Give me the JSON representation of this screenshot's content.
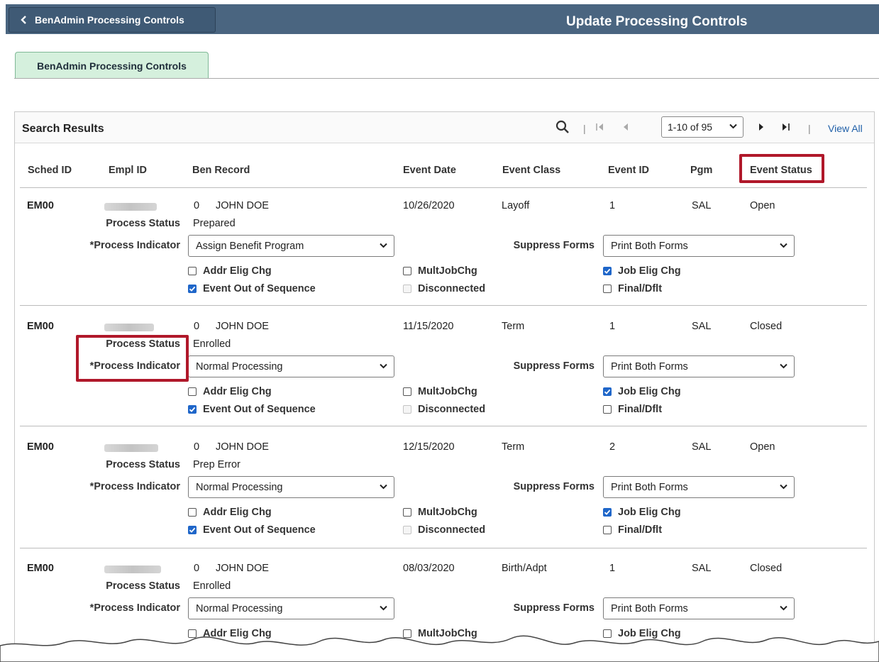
{
  "header": {
    "back_label": "BenAdmin Processing Controls",
    "title": "Update Processing Controls"
  },
  "tab": {
    "label": "BenAdmin Processing Controls"
  },
  "grid": {
    "title": "Search Results",
    "range": "1-10 of 95",
    "view_all": "View All",
    "columns": [
      "Sched ID",
      "Empl ID",
      "Ben Record",
      "Event Date",
      "Event Class",
      "Event ID",
      "Pgm",
      "Event Status"
    ]
  },
  "labels": {
    "process_status": "Process Status",
    "process_indicator": "*Process Indicator",
    "suppress_forms": "Suppress Forms",
    "addr_elig": "Addr Elig Chg",
    "event_oos": "Event Out of Sequence",
    "multjob": "MultJobChg",
    "disconnected": "Disconnected",
    "job_elig": "Job Elig Chg",
    "final_dflt": "Final/Dflt"
  },
  "rows": [
    {
      "sched_id": "EM00",
      "ben_record": "0",
      "name": "JOHN DOE",
      "event_date": "10/26/2020",
      "event_class": "Layoff",
      "event_id": "1",
      "pgm": "SAL",
      "event_status": "Open",
      "process_status": "Prepared",
      "process_indicator": "Assign Benefit Program",
      "suppress_forms": "Print Both Forms",
      "addr_elig": false,
      "event_oos": true,
      "multjob": false,
      "disconnected": false,
      "job_elig": true,
      "final_dflt": false
    },
    {
      "sched_id": "EM00",
      "ben_record": "0",
      "name": "JOHN DOE",
      "event_date": "11/15/2020",
      "event_class": "Term",
      "event_id": "1",
      "pgm": "SAL",
      "event_status": "Closed",
      "process_status": "Enrolled",
      "process_indicator": "Normal Processing",
      "suppress_forms": "Print Both Forms",
      "addr_elig": false,
      "event_oos": true,
      "multjob": false,
      "disconnected": false,
      "job_elig": true,
      "final_dflt": false
    },
    {
      "sched_id": "EM00",
      "ben_record": "0",
      "name": "JOHN DOE",
      "event_date": "12/15/2020",
      "event_class": "Term",
      "event_id": "2",
      "pgm": "SAL",
      "event_status": "Open",
      "process_status": "Prep Error",
      "process_indicator": "Normal Processing",
      "suppress_forms": "Print Both Forms",
      "addr_elig": false,
      "event_oos": true,
      "multjob": false,
      "disconnected": false,
      "job_elig": true,
      "final_dflt": false
    },
    {
      "sched_id": "EM00",
      "ben_record": "0",
      "name": "JOHN DOE",
      "event_date": "08/03/2020",
      "event_class": "Birth/Adpt",
      "event_id": "1",
      "pgm": "SAL",
      "event_status": "Closed",
      "process_status": "Enrolled",
      "process_indicator": "Normal Processing",
      "suppress_forms": "Print Both Forms",
      "addr_elig": false,
      "event_oos": true,
      "multjob": false,
      "disconnected": false,
      "job_elig": false,
      "final_dflt": false
    }
  ],
  "colors": {
    "header_bg": "#4a6580",
    "tab_bg": "#d5f0dd",
    "link": "#1f5fa8",
    "callout": "#b0182a",
    "checkbox": "#1f66c9"
  },
  "icons": [
    "chevron-left-icon",
    "search-icon",
    "first-page-icon",
    "previous-page-icon",
    "next-page-icon",
    "last-page-icon",
    "dropdown-chevron-icon"
  ]
}
